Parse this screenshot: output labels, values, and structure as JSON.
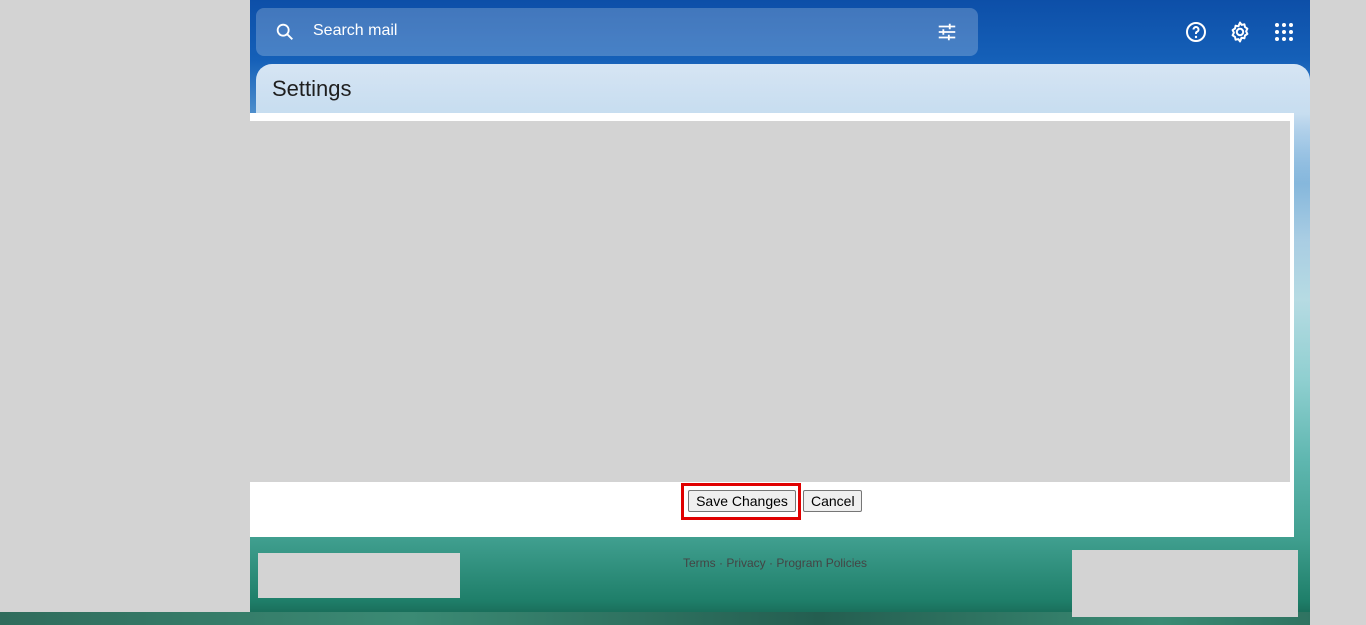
{
  "search": {
    "placeholder": "Search mail"
  },
  "header": {
    "help_icon": "help-circle-icon",
    "settings_icon": "gear-icon",
    "apps_icon": "apps-grid-icon"
  },
  "panel": {
    "title": "Settings"
  },
  "buttons": {
    "save": "Save Changes",
    "cancel": "Cancel"
  },
  "footer": {
    "terms": "Terms",
    "sep1": " · ",
    "privacy": "Privacy",
    "sep2": " · ",
    "policies": "Program Policies"
  },
  "colors": {
    "highlight": "#e00000",
    "header_blue": "#0d4fa8"
  }
}
